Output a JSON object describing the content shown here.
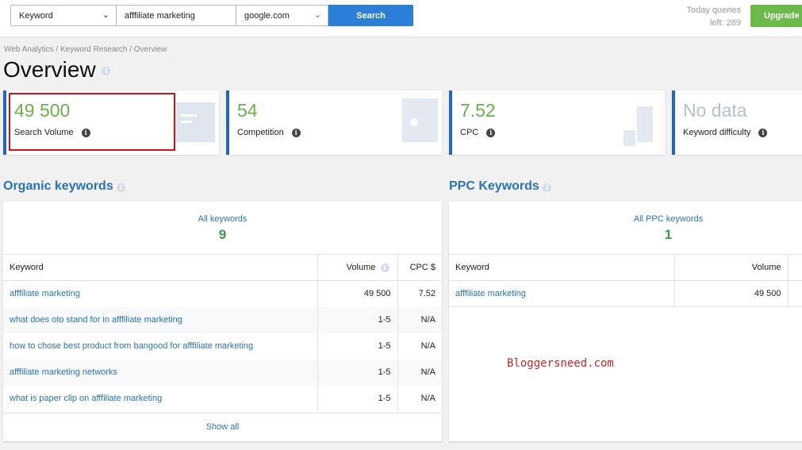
{
  "search": {
    "type": "Keyword",
    "query": "afffiliate marketing",
    "engine": "google.com",
    "button": "Search"
  },
  "queries": {
    "line1": "Today queries",
    "line2": "left: 289"
  },
  "upgrade": "Upgrade y",
  "breadcrumb": "Web Analytics / Keyword Research / Overview",
  "title": "Overview",
  "cards": [
    {
      "value": "49 500",
      "label": "Search Volume"
    },
    {
      "value": "54",
      "label": "Competition"
    },
    {
      "value": "7.52",
      "label": "CPC"
    },
    {
      "value": "No data",
      "label": "Keyword difficulty"
    }
  ],
  "organic": {
    "title": "Organic keywords",
    "link": "All keywords",
    "count": "9",
    "columns": [
      "Keyword",
      "Volume",
      "CPC $"
    ],
    "rows": [
      [
        "afffiliate marketing",
        "49 500",
        "7.52"
      ],
      [
        "what does oto stand for in afffiliate marketing",
        "1-5",
        "N/A"
      ],
      [
        "how to chose best product from bangood for afffiliate marketing",
        "1-5",
        "N/A"
      ],
      [
        "afffiliate marketing networks",
        "1-5",
        "N/A"
      ],
      [
        "what is paper clip on afffiliate marketing",
        "1-5",
        "N/A"
      ]
    ],
    "show_all": "Show all"
  },
  "ppc": {
    "title": "PPC Keywords",
    "link": "All PPC keywords",
    "count": "1",
    "columns": [
      "Keyword",
      "Volume"
    ],
    "rows": [
      [
        "afffiliate marketing",
        "49 500"
      ]
    ]
  },
  "watermark": "Bloggersneed.com",
  "colors": {
    "accent": "#2a73b5",
    "positive": "#6ab04c",
    "search_button": "#2b7fd6",
    "upgrade": "#6cb94c",
    "highlight": "#d0121b"
  }
}
